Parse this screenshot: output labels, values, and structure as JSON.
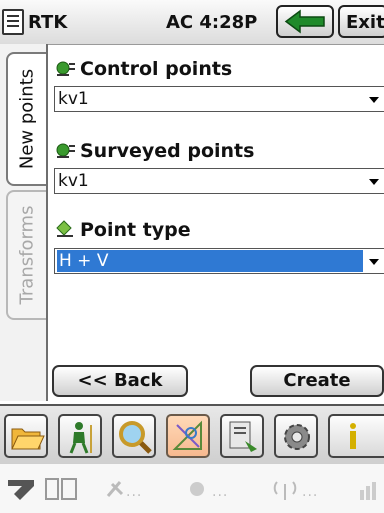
{
  "title_bar": {
    "menu_icon": "menu-icon",
    "app_title": "RTK",
    "status_text": "AC  4:28P",
    "back_icon": "green-arrow-left-icon",
    "exit_label": "Exit"
  },
  "tabs": [
    {
      "label": "New points",
      "active": true
    },
    {
      "label": "Transforms",
      "active": false
    }
  ],
  "form": {
    "control_points": {
      "label": "Control points",
      "value": "kv1",
      "icon": "control-points-icon"
    },
    "surveyed_points": {
      "label": "Surveyed points",
      "value": "kv1",
      "icon": "surveyed-points-icon"
    },
    "point_type": {
      "label": "Point type",
      "value": "H + V",
      "icon": "point-type-icon"
    }
  },
  "actions": {
    "back_label": "<< Back",
    "create_label": "Create"
  },
  "toolbar": [
    {
      "name": "open-folder-icon"
    },
    {
      "name": "surveyor-tripod-icon"
    },
    {
      "name": "magnifier-icon"
    },
    {
      "name": "cogo-drawing-icon",
      "active": true
    },
    {
      "name": "data-export-icon"
    },
    {
      "name": "settings-gear-icon"
    },
    {
      "name": "info-icon"
    }
  ],
  "status_icons": [
    {
      "name": "gps-signal-icon"
    },
    {
      "name": "battery-icon"
    },
    {
      "name": "satellite-icon",
      "text": "..."
    },
    {
      "name": "correction-link-icon",
      "text": "..."
    },
    {
      "name": "radio-antenna-icon",
      "text": "..."
    },
    {
      "name": "bar-signal-icon"
    }
  ],
  "colors": {
    "selection": "#2f79d3",
    "active_tool": "#f7b98f",
    "arrow_green": "#1f8a2a"
  }
}
